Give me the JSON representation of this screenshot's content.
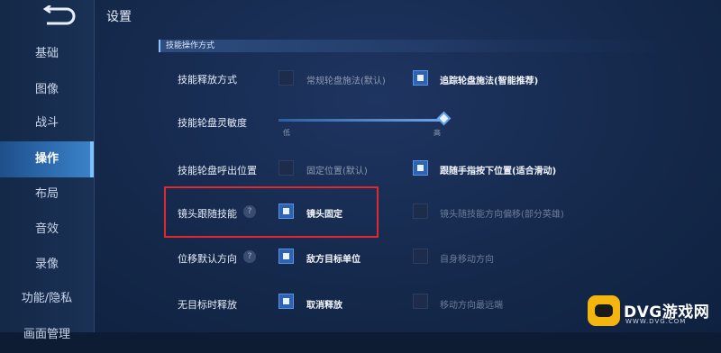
{
  "header": {
    "title": "设置"
  },
  "sidebar": {
    "items": [
      {
        "label": "基础"
      },
      {
        "label": "图像"
      },
      {
        "label": "战斗"
      },
      {
        "label": "操作"
      },
      {
        "label": "布局"
      },
      {
        "label": "音效"
      },
      {
        "label": "录像"
      },
      {
        "label": "功能/隐私"
      },
      {
        "label": "画面管理"
      }
    ],
    "active": "操作"
  },
  "section": {
    "title": "技能操作方式"
  },
  "rows": {
    "cast_mode": {
      "label": "技能释放方式",
      "options": [
        {
          "label": "常规轮盘施法(默认)",
          "checked": false
        },
        {
          "label": "追踪轮盘施法(智能推荐)",
          "checked": true
        }
      ]
    },
    "sensitivity": {
      "label": "技能轮盘灵敏度",
      "low": "低",
      "high": "高",
      "value_fraction": 1.0
    },
    "wheel_position": {
      "label": "技能轮盘呼出位置",
      "options": [
        {
          "label": "固定位置(默认)",
          "checked": false
        },
        {
          "label": "跟随手指按下位置(适合滑动)",
          "checked": true
        }
      ]
    },
    "camera_follow": {
      "label": "镜头跟随技能",
      "help": "?",
      "options": [
        {
          "label": "镜头固定",
          "checked": true
        },
        {
          "label": "镜头随技能方向偏移(部分英雄)",
          "checked": false
        }
      ]
    },
    "move_direction": {
      "label": "位移默认方向",
      "help": "?",
      "options": [
        {
          "label": "敌方目标单位",
          "checked": true
        },
        {
          "label": "自身移动方向",
          "checked": false
        }
      ]
    },
    "no_target": {
      "label": "无目标时释放",
      "options": [
        {
          "label": "取消释放",
          "checked": true
        },
        {
          "label": "移动方向最远端",
          "checked": false
        }
      ]
    }
  },
  "watermark": {
    "brand": "DVG游戏网",
    "url": "WWW.DVG.COM"
  },
  "colors": {
    "accent": "#2d63b2",
    "highlight_border": "#e0282f",
    "logo_yellow": "#f5b50f"
  }
}
